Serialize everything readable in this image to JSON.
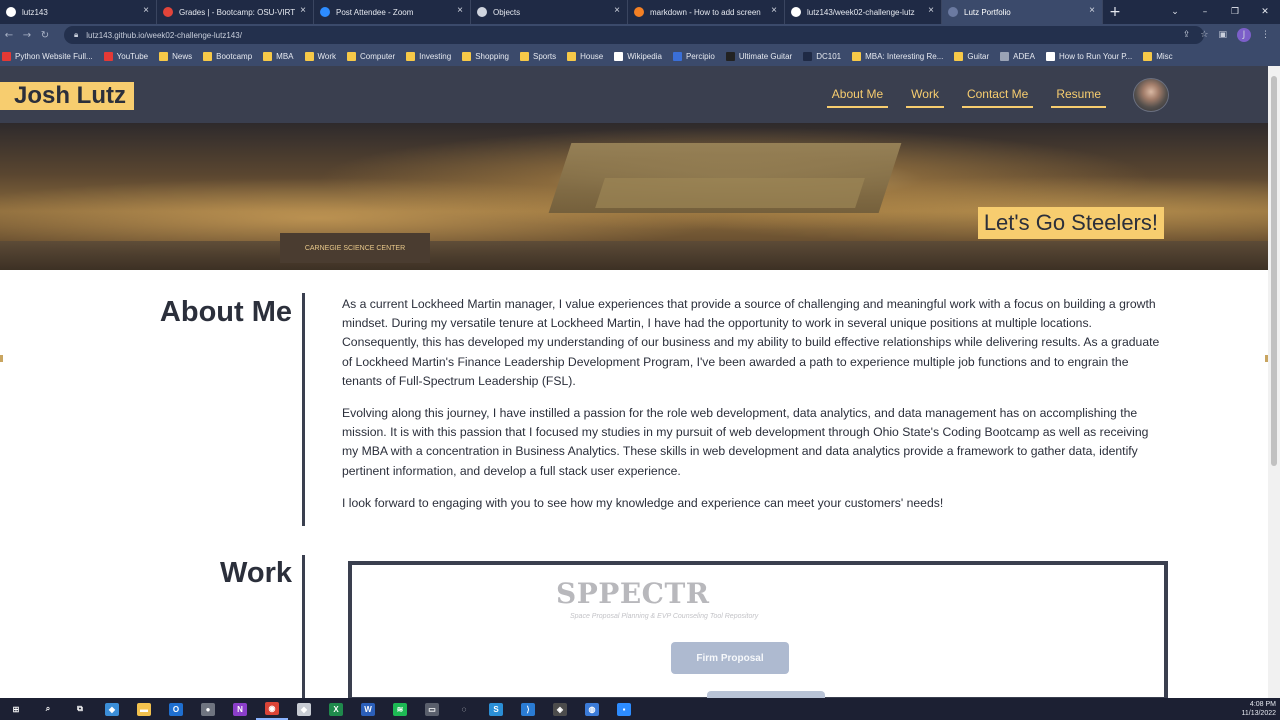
{
  "browser": {
    "tabs": [
      {
        "title": "lutz143",
        "favicon_color": "#ffffff",
        "active": false
      },
      {
        "title": "Grades | - Bootcamp: OSU-VIRT",
        "favicon_color": "#e2443a",
        "active": false
      },
      {
        "title": "Post Attendee - Zoom",
        "favicon_color": "#2d8cff",
        "active": false
      },
      {
        "title": "Objects",
        "favicon_color": "#cfd4de",
        "active": false
      },
      {
        "title": "markdown - How to add screen",
        "favicon_color": "#f48024",
        "active": false
      },
      {
        "title": "lutz143/week02-challenge-lutz",
        "favicon_color": "#ffffff",
        "active": false
      },
      {
        "title": "Lutz Portfolio",
        "favicon_color": "#6b7aa1",
        "active": true
      }
    ],
    "new_tab_label": "+",
    "close_label": "×",
    "url": "lutz143.github.io/week02-challenge-lutz143/",
    "window_controls": [
      "⌄",
      "–",
      "❐",
      "✕"
    ],
    "profile_initial": "J",
    "bookmarks": [
      {
        "label": "Python Website Full...",
        "color": "#e53935"
      },
      {
        "label": "YouTube",
        "color": "#e53935"
      },
      {
        "label": "News",
        "color": "#f7c948"
      },
      {
        "label": "Bootcamp",
        "color": "#f7c948"
      },
      {
        "label": "MBA",
        "color": "#f7c948"
      },
      {
        "label": "Work",
        "color": "#f7c948"
      },
      {
        "label": "Computer",
        "color": "#f7c948"
      },
      {
        "label": "Investing",
        "color": "#f7c948"
      },
      {
        "label": "Shopping",
        "color": "#f7c948"
      },
      {
        "label": "Sports",
        "color": "#f7c948"
      },
      {
        "label": "House",
        "color": "#f7c948"
      },
      {
        "label": "Wikipedia",
        "color": "#ffffff"
      },
      {
        "label": "Percipio",
        "color": "#3a6fd8"
      },
      {
        "label": "Ultimate Guitar",
        "color": "#222222"
      },
      {
        "label": "DC101",
        "color": "#1f2a45"
      },
      {
        "label": "MBA: Interesting Re...",
        "color": "#f7c948"
      },
      {
        "label": "Guitar",
        "color": "#f7c948"
      },
      {
        "label": "ADEA",
        "color": "#9aa3b5"
      },
      {
        "label": "How to Run Your P...",
        "color": "#ffffff"
      },
      {
        "label": "Misc",
        "color": "#f7c948"
      }
    ]
  },
  "site": {
    "brand": "Josh Lutz",
    "nav": [
      "About Me",
      "Work",
      "Contact Me",
      "Resume"
    ],
    "hero_caption": "Let's Go Steelers!",
    "hero_sign": "CARNEGIE SCIENCE CENTER",
    "about": {
      "title": "About Me",
      "paragraphs": [
        "As a current Lockheed Martin manager, I value experiences that provide a source of challenging and meaningful work with a focus on building a growth mindset. During my versatile tenure at Lockheed Martin, I have had the opportunity to work in several unique positions at multiple locations. Consequently, this has developed my understanding of our business and my ability to build effective relationships while delivering results. As a graduate of Lockheed Martin's Finance Leadership Development Program, I've been awarded a path to experience multiple job functions and to engrain the tenants of Full-Spectrum Leadership (FSL).",
        "Evolving along this journey, I have instilled a passion for the role web development, data analytics, and data management has on accomplishing the mission. It is with this passion that I focused my studies in my pursuit of web development through Ohio State's Coding Bootcamp as well as receiving my MBA with a concentration in Business Analytics. These skills in web development and data analytics provide a framework to gather data, identify pertinent information, and develop a full stack user experience.",
        "I look forward to engaging with you to see how my knowledge and experience can meet your customers' needs!"
      ]
    },
    "work": {
      "title": "Work",
      "project_logo": "SPPECTR",
      "project_tagline": "Space Proposal Planning & EVP Counseling Tool Repository",
      "project_button": "Firm Proposal"
    }
  },
  "taskbar": {
    "apps": [
      {
        "name": "start",
        "glyph": "⊞",
        "color": "#1c2033"
      },
      {
        "name": "search",
        "glyph": "⌕",
        "color": "#1c2033"
      },
      {
        "name": "task-view",
        "glyph": "⧉",
        "color": "#1c2033"
      },
      {
        "name": "app-blue",
        "glyph": "◆",
        "color": "#3b8ed8"
      },
      {
        "name": "file-explorer",
        "glyph": "▬",
        "color": "#f2c14e"
      },
      {
        "name": "outlook",
        "glyph": "O",
        "color": "#1f6fd0"
      },
      {
        "name": "app-dark",
        "glyph": "●",
        "color": "#6f7480"
      },
      {
        "name": "onenote",
        "glyph": "N",
        "color": "#8a3ec9"
      },
      {
        "name": "chrome",
        "glyph": "◉",
        "color": "#db4437"
      },
      {
        "name": "app-gray",
        "glyph": "◆",
        "color": "#c8ccd4"
      },
      {
        "name": "excel",
        "glyph": "X",
        "color": "#1f8a4c"
      },
      {
        "name": "word",
        "glyph": "W",
        "color": "#2b5fb9"
      },
      {
        "name": "spotify",
        "glyph": "≋",
        "color": "#1db954"
      },
      {
        "name": "app-window",
        "glyph": "▭",
        "color": "#5a5f6c"
      },
      {
        "name": "app-orange",
        "glyph": "◌",
        "color": "#1c2033"
      },
      {
        "name": "app-s",
        "glyph": "S",
        "color": "#2b8fd6"
      },
      {
        "name": "vscode",
        "glyph": "⟩",
        "color": "#2a7bd3"
      },
      {
        "name": "git",
        "glyph": "◈",
        "color": "#4c4c4c"
      },
      {
        "name": "app-globe",
        "glyph": "◍",
        "color": "#3b7bd8"
      },
      {
        "name": "zoom",
        "glyph": "▪",
        "color": "#2d8cff"
      }
    ],
    "time": "4:08 PM",
    "date": "11/13/2022"
  }
}
